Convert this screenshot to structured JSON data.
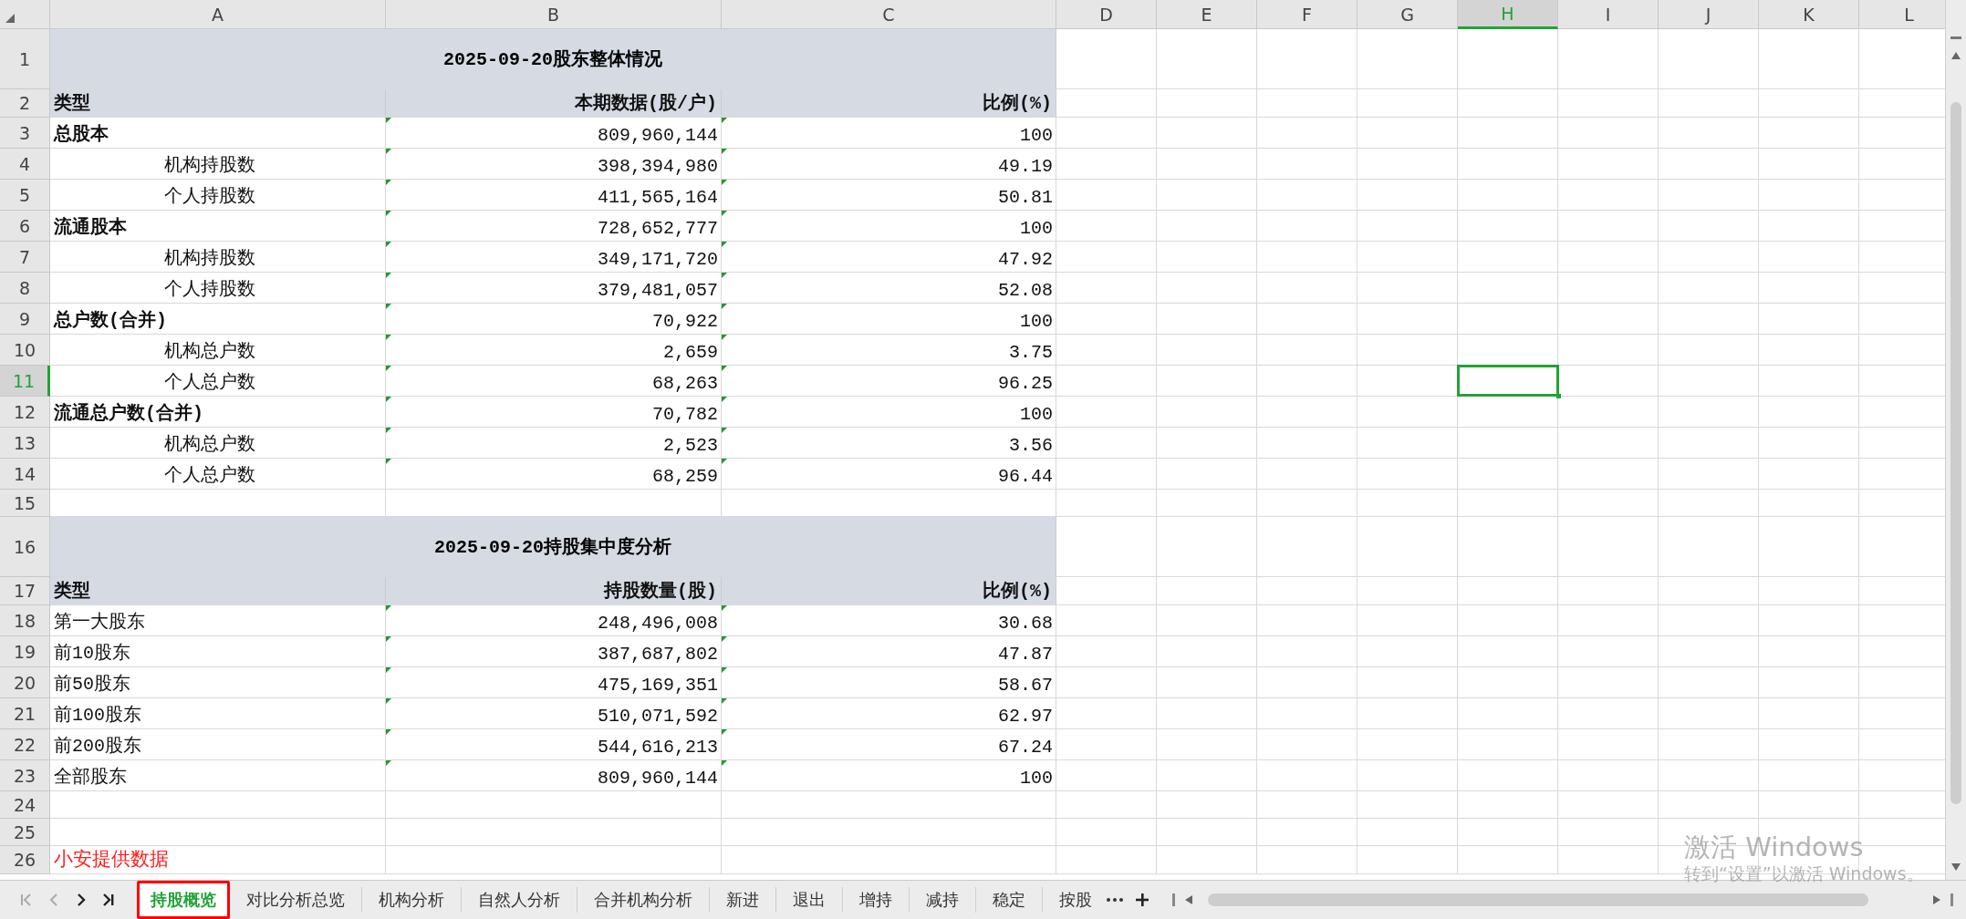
{
  "sheet": {
    "column_headers": [
      {
        "label": "A",
        "selected": false
      },
      {
        "label": "B",
        "selected": false
      },
      {
        "label": "C",
        "selected": false
      },
      {
        "label": "D",
        "selected": false
      },
      {
        "label": "E",
        "selected": false
      },
      {
        "label": "F",
        "selected": false
      },
      {
        "label": "G",
        "selected": false
      },
      {
        "label": "H",
        "selected": true
      },
      {
        "label": "I",
        "selected": false
      },
      {
        "label": "J",
        "selected": false
      },
      {
        "label": "K",
        "selected": false
      },
      {
        "label": "L",
        "selected": false
      }
    ],
    "rows": [
      {
        "number": "1",
        "kind": "title",
        "text": "2025-09-20股东整体情况",
        "selected": false
      },
      {
        "number": "2",
        "kind": "header",
        "cells": [
          "类型",
          "本期数据(股/户)",
          "比例(%)"
        ],
        "selected": false
      },
      {
        "number": "3",
        "kind": "group",
        "cells": [
          "总股本",
          "809,960,144",
          "100"
        ],
        "selected": false,
        "children": [
          {
            "number": "4",
            "cells": [
              "机构持股数",
              "398,394,980",
              "49.19"
            ],
            "selected": false
          },
          {
            "number": "5",
            "cells": [
              "个人持股数",
              "411,565,164",
              "50.81"
            ],
            "selected": false
          }
        ]
      },
      {
        "number": "6",
        "kind": "group",
        "cells": [
          "流通股本",
          "728,652,777",
          "100"
        ],
        "selected": false,
        "children": [
          {
            "number": "7",
            "cells": [
              "机构持股数",
              "349,171,720",
              "47.92"
            ],
            "selected": false
          },
          {
            "number": "8",
            "cells": [
              "个人持股数",
              "379,481,057",
              "52.08"
            ],
            "selected": false
          }
        ]
      },
      {
        "number": "9",
        "kind": "group",
        "cells": [
          "总户数(合并)",
          "70,922",
          "100"
        ],
        "selected": false,
        "children": [
          {
            "number": "10",
            "cells": [
              "机构总户数",
              "2,659",
              "3.75"
            ],
            "selected": false
          },
          {
            "number": "11",
            "cells": [
              "个人总户数",
              "68,263",
              "96.25"
            ],
            "selected": true
          }
        ]
      },
      {
        "number": "12",
        "kind": "group",
        "cells": [
          "流通总户数(合并)",
          "70,782",
          "100"
        ],
        "selected": false,
        "children": [
          {
            "number": "13",
            "cells": [
              "机构总户数",
              "2,523",
              "3.56"
            ],
            "selected": false
          },
          {
            "number": "14",
            "cells": [
              "个人总户数",
              "68,259",
              "96.44"
            ],
            "selected": false
          }
        ]
      },
      {
        "number": "15",
        "kind": "empty",
        "selected": false
      },
      {
        "number": "16",
        "kind": "title",
        "text": "2025-09-20持股集中度分析",
        "selected": false
      },
      {
        "number": "17",
        "kind": "header",
        "cells": [
          "类型",
          "持股数量(股)",
          "比例(%)"
        ],
        "selected": false
      },
      {
        "number": "18",
        "kind": "plain",
        "cells": [
          "第一大股东",
          "248,496,008",
          "30.68"
        ],
        "selected": false
      },
      {
        "number": "19",
        "kind": "plain",
        "cells": [
          "前10股东",
          "387,687,802",
          "47.87"
        ],
        "selected": false
      },
      {
        "number": "20",
        "kind": "plain",
        "cells": [
          "前50股东",
          "475,169,351",
          "58.67"
        ],
        "selected": false
      },
      {
        "number": "21",
        "kind": "plain",
        "cells": [
          "前100股东",
          "510,071,592",
          "62.97"
        ],
        "selected": false
      },
      {
        "number": "22",
        "kind": "plain",
        "cells": [
          "前200股东",
          "544,616,213",
          "67.24"
        ],
        "selected": false
      },
      {
        "number": "23",
        "kind": "plain",
        "cells": [
          "全部股东",
          "809,960,144",
          "100"
        ],
        "selected": false
      },
      {
        "number": "24",
        "kind": "empty",
        "selected": false
      },
      {
        "number": "25",
        "kind": "empty",
        "selected": false
      },
      {
        "number": "26",
        "kind": "note",
        "text": "小安提供数据",
        "selected": false
      }
    ]
  },
  "sheet_tabs": [
    {
      "label": "持股概览",
      "selected": true
    },
    {
      "label": "对比分析总览",
      "selected": false
    },
    {
      "label": "机构分析",
      "selected": false
    },
    {
      "label": "自然人分析",
      "selected": false
    },
    {
      "label": "合并机构分析",
      "selected": false
    },
    {
      "label": "新进",
      "selected": false
    },
    {
      "label": "退出",
      "selected": false
    },
    {
      "label": "增持",
      "selected": false
    },
    {
      "label": "减持",
      "selected": false
    },
    {
      "label": "稳定",
      "selected": false
    },
    {
      "label": "按股",
      "selected": false
    }
  ],
  "activation_notice": {
    "title": "激活 Windows",
    "message": "转到“设置”以激活 Windows。"
  }
}
